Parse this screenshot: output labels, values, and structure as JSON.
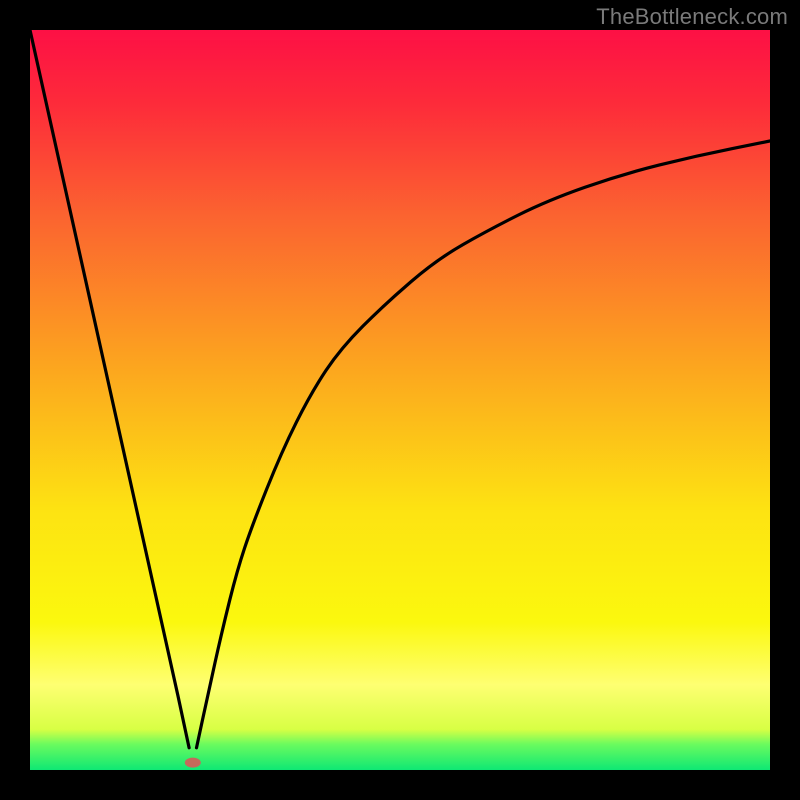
{
  "watermark": "TheBottleneck.com",
  "chart_data": {
    "type": "line",
    "title": "",
    "xlabel": "",
    "ylabel": "",
    "xlim": [
      0,
      100
    ],
    "ylim": [
      0,
      100
    ],
    "x_min_at": 22,
    "series": [
      {
        "name": "left-descent",
        "x": [
          0,
          4,
          8,
          12,
          16,
          20,
          21.5
        ],
        "y": [
          100,
          82,
          64,
          46,
          28,
          10,
          3
        ]
      },
      {
        "name": "right-ascent",
        "x": [
          22.5,
          24,
          26,
          28,
          30,
          34,
          38,
          42,
          48,
          55,
          62,
          70,
          80,
          90,
          100
        ],
        "y": [
          3,
          10,
          19,
          27,
          33,
          43,
          51,
          57,
          63,
          69,
          73,
          77,
          80.5,
          83,
          85
        ]
      }
    ],
    "bottom_band": {
      "green_y": [
        0.0,
        3.5
      ],
      "yellow_band_y": [
        3.5,
        12.0
      ]
    },
    "marker": {
      "name": "min-point-marker",
      "x": 22,
      "y": 1.0,
      "color": "#c46a5b",
      "rx": 8,
      "ry": 5
    },
    "gradient_stops": [
      {
        "offset": 0.0,
        "color": "#fd1045"
      },
      {
        "offset": 0.1,
        "color": "#fd2b3a"
      },
      {
        "offset": 0.25,
        "color": "#fb6330"
      },
      {
        "offset": 0.45,
        "color": "#fca41f"
      },
      {
        "offset": 0.65,
        "color": "#fde312"
      },
      {
        "offset": 0.8,
        "color": "#fbf80e"
      },
      {
        "offset": 0.885,
        "color": "#feff72"
      },
      {
        "offset": 0.945,
        "color": "#d8ff44"
      },
      {
        "offset": 0.965,
        "color": "#6bfb5e"
      },
      {
        "offset": 1.0,
        "color": "#0ee874"
      }
    ]
  }
}
